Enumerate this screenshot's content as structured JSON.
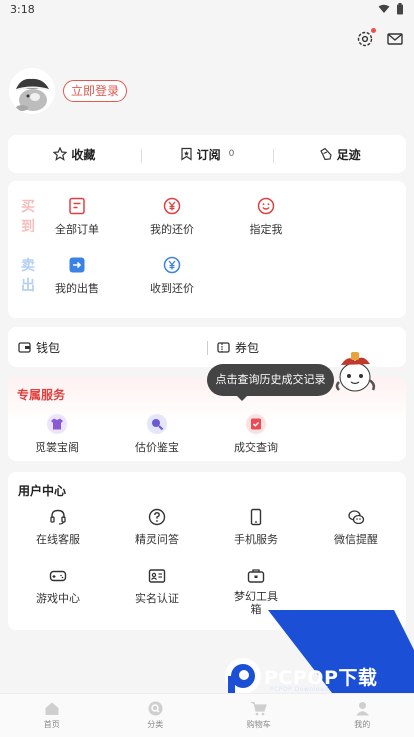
{
  "status_bar": {
    "time": "3:18"
  },
  "profile": {
    "login_label": "立即登录"
  },
  "quick_tabs": {
    "favorites": "收藏",
    "subscriptions": "订阅",
    "subscriptions_count": "0",
    "footprints": "足迹"
  },
  "orders": {
    "buy_label": "买到",
    "sell_label": "卖出",
    "buy_items": [
      "全部订单",
      "我的还价",
      "指定我"
    ],
    "sell_items": [
      "我的出售",
      "收到还价"
    ]
  },
  "wallet": {
    "wallet_label": "钱包",
    "coupon_label": "券包"
  },
  "exclusive": {
    "title": "专属服务",
    "items": [
      "觅裳宝阁",
      "估价鉴宝",
      "成交查询"
    ],
    "tooltip": "点击查询历史成交记录"
  },
  "user_center": {
    "title": "用户中心",
    "items": [
      "在线客服",
      "精灵问答",
      "手机服务",
      "微信提醒",
      "游戏中心",
      "实名认证",
      "梦幻工具箱"
    ]
  },
  "watermark": {
    "text": "PCPOP下载",
    "sub": "PCPOP Download"
  },
  "tabbar": [
    "首页",
    "分类",
    "购物车",
    "我的"
  ],
  "colors": {
    "accent_red": "#e0413f",
    "buy_pink": "#f6bfbd",
    "sell_blue": "#b4cff2",
    "watermark_blue": "#1a4fd6"
  }
}
